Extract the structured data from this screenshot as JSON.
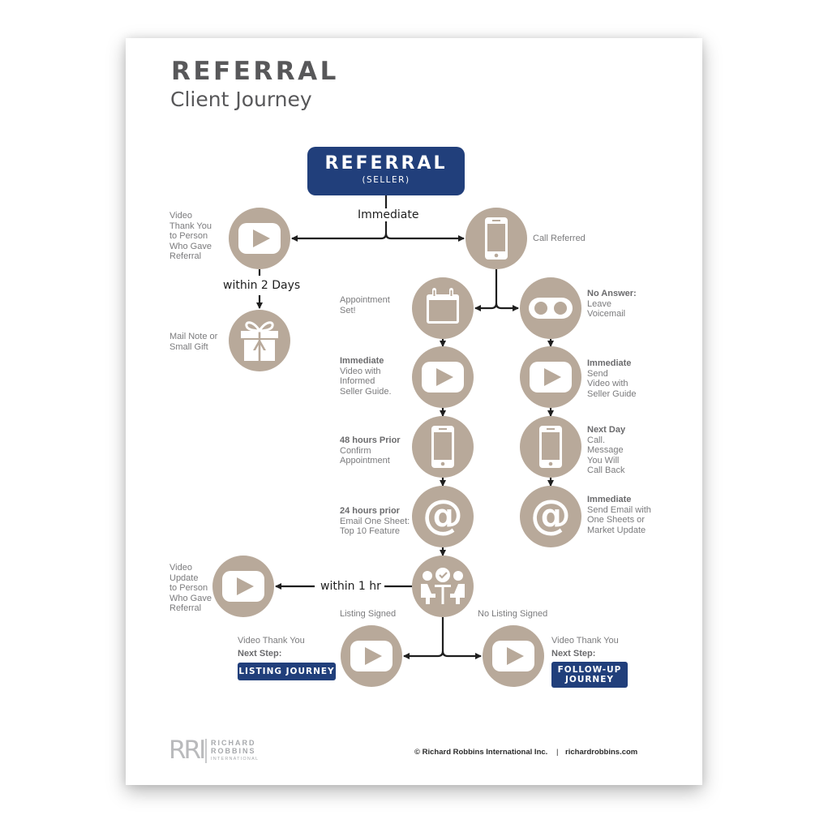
{
  "header": {
    "title": "REFERRAL",
    "subtitle": "Client Journey"
  },
  "start_box": {
    "title": "REFERRAL",
    "subtitle": "(SELLER)"
  },
  "colors": {
    "brand_blue": "#213f7b",
    "circle_fill": "#b8a99a",
    "icon_fill": "#ffffff",
    "connector": "#1e1e1e",
    "label_text": "#7b7b7d",
    "heading_text": "#58585a"
  },
  "connector_labels": {
    "immediate": "Immediate",
    "within_2_days": "within 2 Days",
    "within_1_hr": "within 1 hr",
    "listing_signed": "Listing Signed",
    "no_listing_signed": "No Listing Signed"
  },
  "steps": {
    "video_thank_you_referrer": {
      "icon": "video-play-icon",
      "lines": [
        "Video",
        "Thank You",
        "to Person",
        "Who Gave",
        "Referral"
      ]
    },
    "call_referred": {
      "icon": "smartphone-icon",
      "lines": [
        "Call Referred"
      ]
    },
    "mail_gift": {
      "icon": "gift-icon",
      "lines": [
        "Mail Note or",
        "Small Gift"
      ]
    },
    "appointment_set": {
      "icon": "calendar-icon",
      "lines": [
        "Appointment",
        "Set!"
      ]
    },
    "no_answer_voicemail": {
      "icon": "voicemail-icon",
      "bold": "No Answer:",
      "lines": [
        "Leave",
        "Voicemail"
      ]
    },
    "video_informed_seller": {
      "icon": "video-play-icon",
      "bold": "Immediate",
      "lines": [
        "Video with",
        "Informed",
        "Seller Guide."
      ]
    },
    "send_video_seller_guide": {
      "icon": "video-play-icon",
      "bold": "Immediate",
      "lines": [
        "Send",
        "Video with",
        "Seller Guide"
      ]
    },
    "confirm_appointment": {
      "icon": "smartphone-icon",
      "bold": "48 hours Prior",
      "lines": [
        "Confirm",
        "Appointment"
      ]
    },
    "next_day_call": {
      "icon": "smartphone-icon",
      "bold": "Next Day",
      "lines": [
        "Call.",
        "Message",
        "You Will",
        "Call Back"
      ]
    },
    "email_one_sheet": {
      "icon": "at-sign-icon",
      "bold": "24 hours prior",
      "lines": [
        "Email One Sheet:",
        "Top 10 Feature"
      ]
    },
    "send_email_market": {
      "icon": "at-sign-icon",
      "bold": "Immediate",
      "lines": [
        "Send Email with",
        "One Sheets or",
        "Market Update"
      ]
    },
    "meeting": {
      "icon": "meeting-icon"
    },
    "video_update_referrer": {
      "icon": "video-play-icon",
      "lines": [
        "Video",
        "Update",
        "to Person",
        "Who Gave",
        "Referral"
      ]
    },
    "listing_video": {
      "icon": "video-play-icon",
      "line": "Video Thank You",
      "bold": "Next Step:",
      "button": "LISTING JOURNEY"
    },
    "followup_video": {
      "icon": "video-play-icon",
      "line": "Video Thank You",
      "bold": "Next Step:",
      "button_lines": [
        "FOLLOW-UP",
        "JOURNEY"
      ]
    }
  },
  "footer": {
    "logo_mark": "RRI",
    "logo_lines": [
      "RICHARD",
      "ROBBINS",
      "INTERNATIONAL"
    ],
    "copyright": "© Richard Robbins International Inc.",
    "separator": "|",
    "website": "richardrobbins.com"
  }
}
